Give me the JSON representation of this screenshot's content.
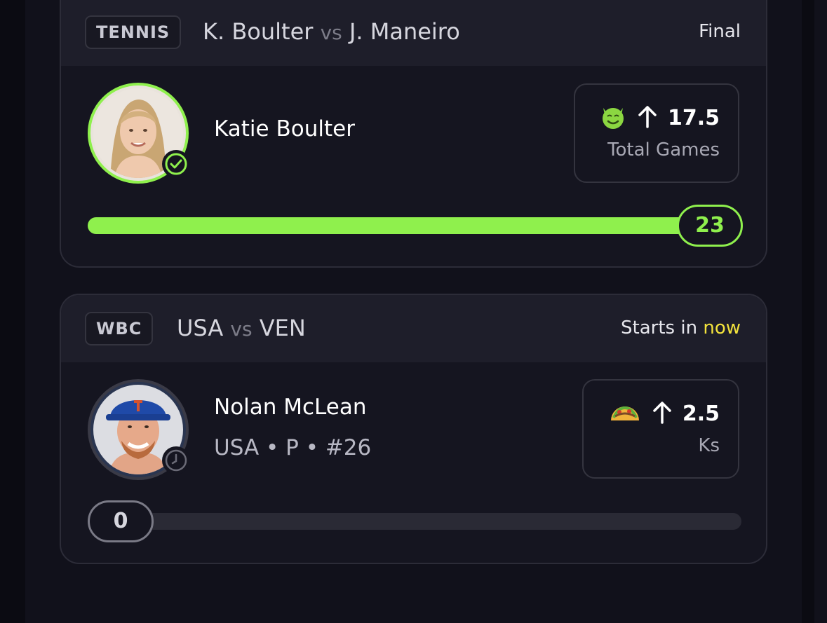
{
  "cards": [
    {
      "sport": "TENNIS",
      "team_a": "K. Boulter",
      "vs": "vs",
      "team_b": "J. Maneiro",
      "status": "Final",
      "player_name": "Katie Boulter",
      "pick_icon": "devil-emoji",
      "pick_direction": "up-arrow-icon",
      "pick_line": "17.5",
      "pick_stat": "Total Games",
      "result_value": "23",
      "progress": 1.0,
      "avatar_badge": "check-circle-icon",
      "accent_color": "#8ff04d"
    },
    {
      "sport": "WBC",
      "team_a": "USA",
      "vs": "vs",
      "team_b": "VEN",
      "status_prefix": "Starts in",
      "status_highlight": "now",
      "player_name": "Nolan McLean",
      "player_meta": "USA • P • #26",
      "pick_icon": "taco-emoji",
      "pick_direction": "up-arrow-icon",
      "pick_line": "2.5",
      "pick_stat": "Ks",
      "result_value": "0",
      "progress": 0.0,
      "avatar_badge": "clock-icon",
      "highlight_color": "#f3e33c"
    }
  ]
}
